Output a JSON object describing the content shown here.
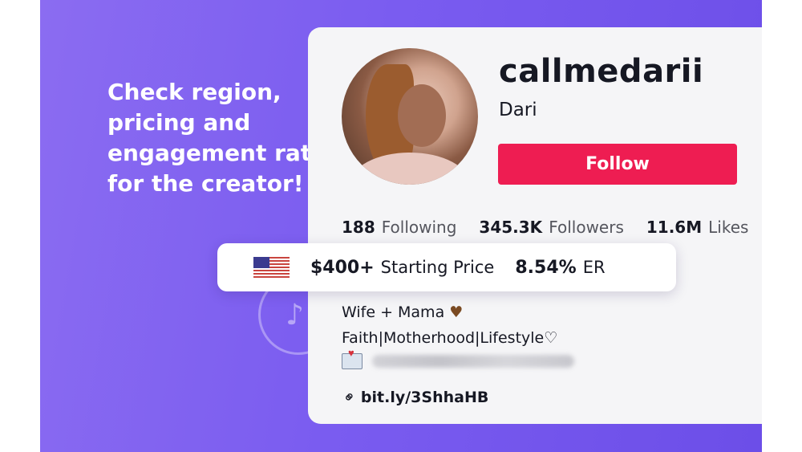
{
  "headline": "Check region, pricing and engagement rate for the creator!",
  "profile": {
    "username": "callmedarii",
    "display_name": "Dari",
    "follow_label": "Follow",
    "stats": [
      {
        "value": "188",
        "label": "Following"
      },
      {
        "value": "345.3K",
        "label": "Followers"
      },
      {
        "value": "11.6M",
        "label": "Likes"
      }
    ],
    "bio_line1": "Wife + Mama",
    "bio_line2": "Faith|Motherhood|Lifestyle",
    "link": "bit.ly/3ShhaHB"
  },
  "pricing": {
    "region_flag": "us-flag-icon",
    "price": "$400+",
    "price_label": "Starting Price",
    "engagement_rate": "8.54%",
    "engagement_label": "ER"
  },
  "colors": {
    "background": "#7a5cf0",
    "follow_button": "#ee1d52",
    "card": "#f5f5f7"
  }
}
